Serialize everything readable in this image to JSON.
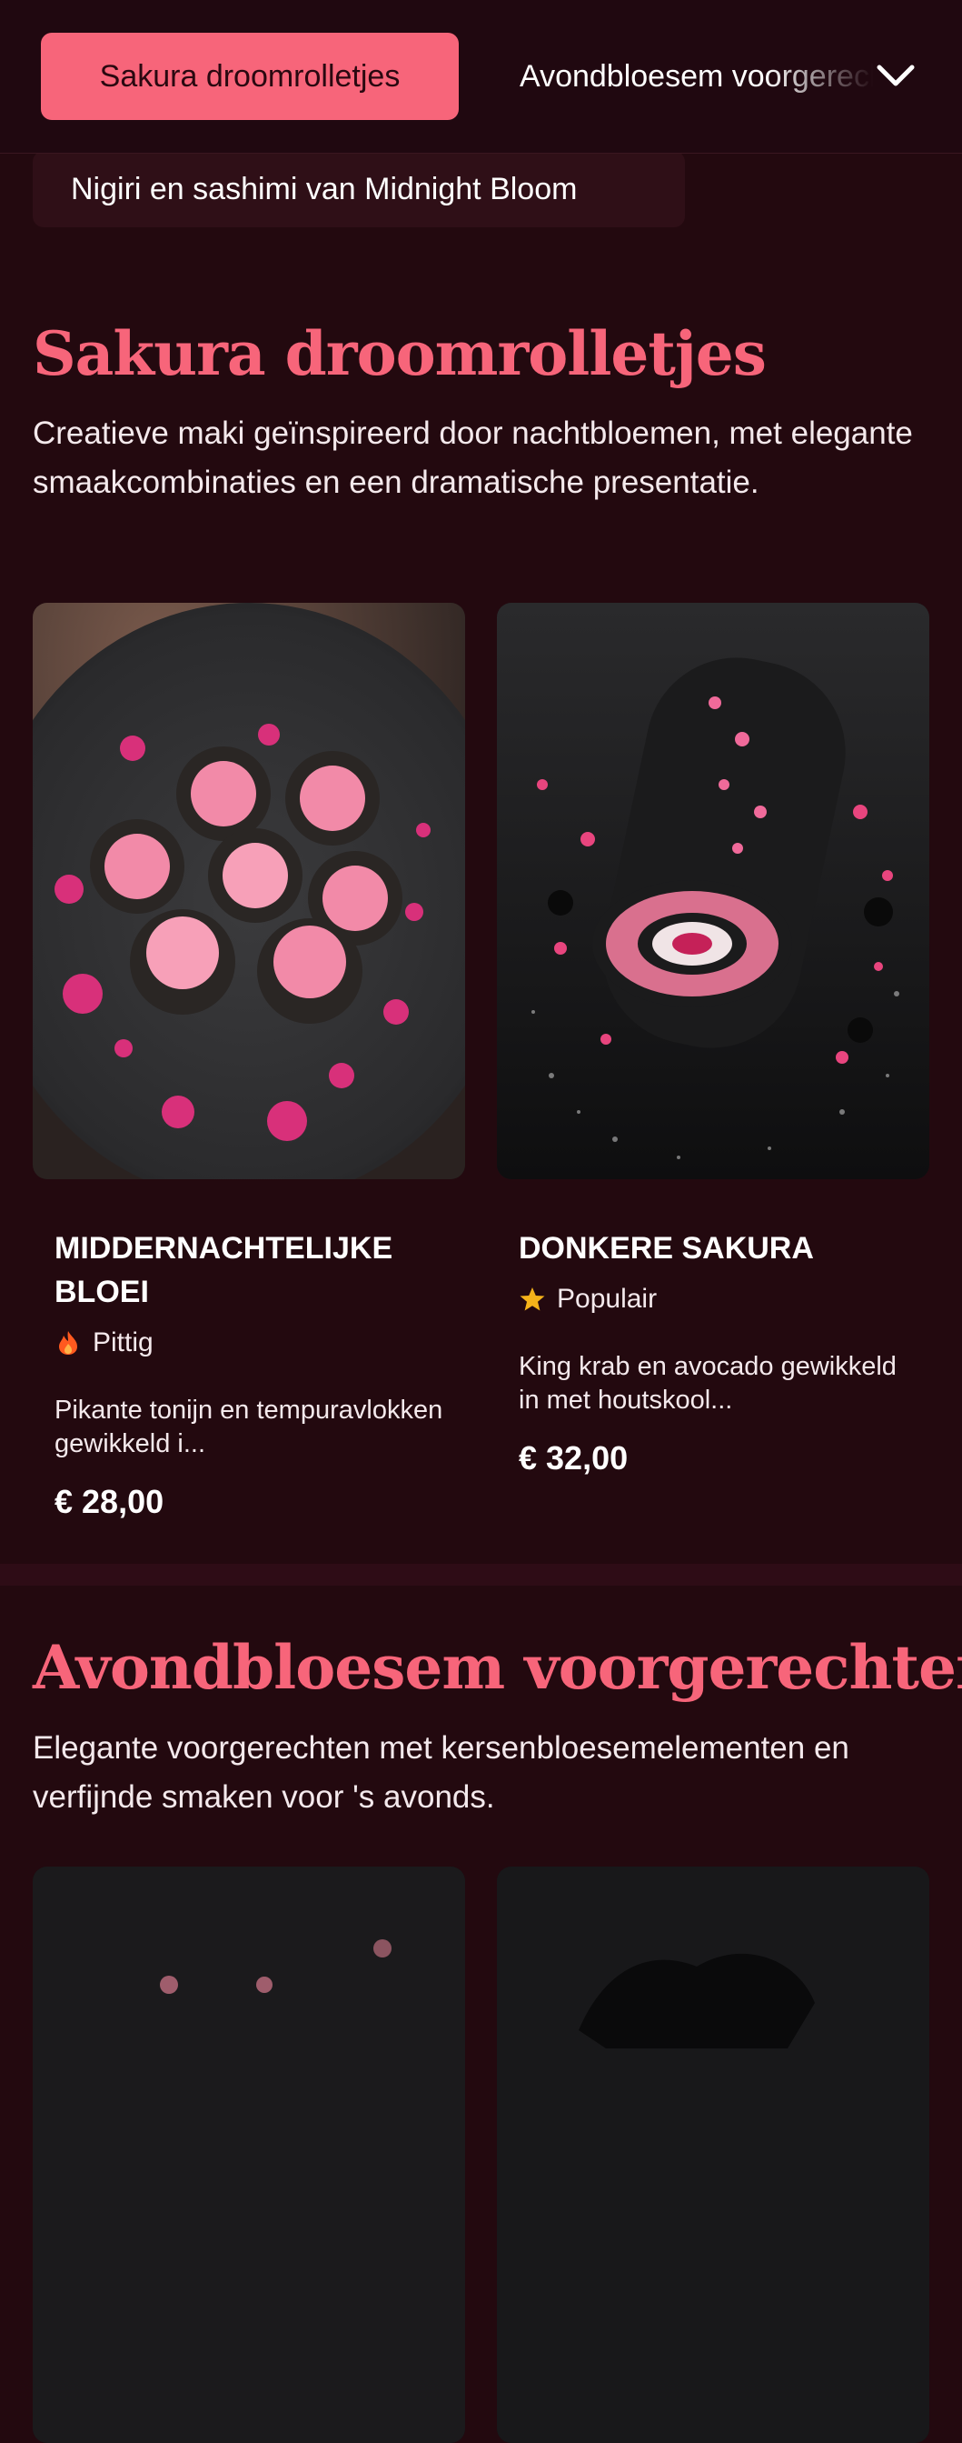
{
  "nav": {
    "active_category": "Sakura droomrolletjes",
    "next_category": "Avondbloesem voorgerechten",
    "secondary_category": "Nigiri en sashimi van Midnight Bloom"
  },
  "sections": [
    {
      "title": "Sakura droomrolletjes",
      "description": "Creatieve maki geïnspireerd door nachtbloemen, met elegante smaakcombinaties en een dramatische presentatie.",
      "items": [
        {
          "name": "Middernachtelijke bloei",
          "tag": "Pittig",
          "tag_icon": "flame-icon",
          "description": "Pikante tonijn en tempuravlokken gewikkeld i...",
          "price": "€ 28,00"
        },
        {
          "name": "Donkere sakura",
          "tag": "Populair",
          "tag_icon": "star-icon",
          "description": "King krab en avocado gewikkeld in met houtskool...",
          "price": "€ 32,00"
        }
      ]
    },
    {
      "title": "Avondbloesem voorgerechten",
      "description": "Elegante voorgerechten met kersenbloesemelementen en verfijnde smaken voor 's avonds."
    }
  ],
  "colors": {
    "background": "#23090f",
    "accent": "#f7657a",
    "pill": "#2f0f17",
    "popular_star": "#f5b31a",
    "spicy_flame": "#ff5a1f"
  }
}
